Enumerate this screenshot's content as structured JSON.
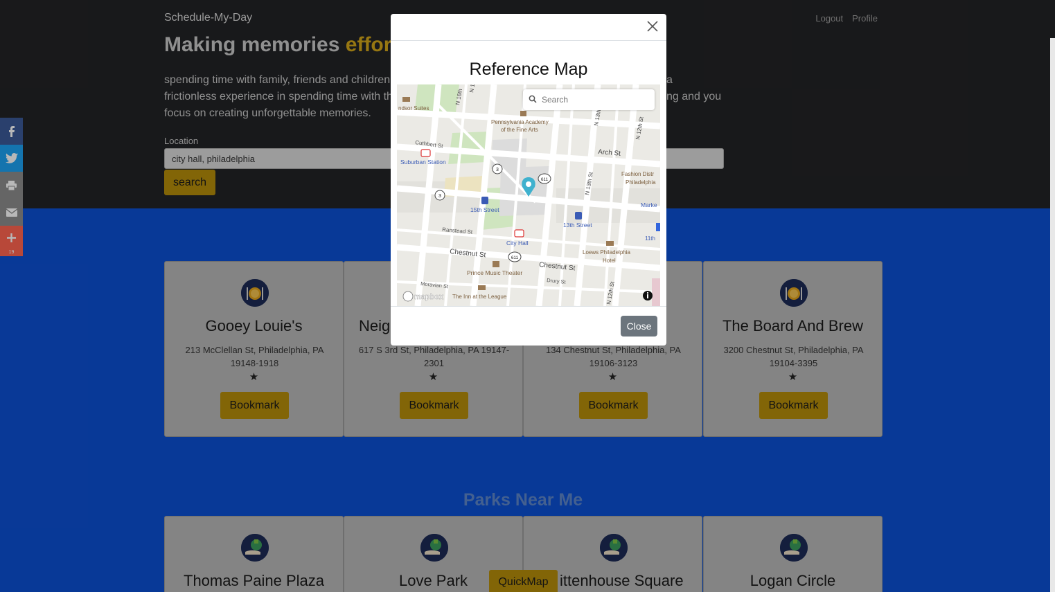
{
  "navbar": {
    "brand": "Schedule-My-Day",
    "links": [
      "Logout",
      "Profile"
    ]
  },
  "hero": {
    "headline": "Making memories ",
    "headline_accent": "effort",
    "tagline_lines": [
      "spending time with family, friends and children a",
      "frictionless experience in spending time with th",
      "focus on creating unforgettable memories."
    ],
    "tagline_right_1": "a",
    "tagline_right_2": "ng and you",
    "location_label": "Location",
    "location_value": "city hall, philadelphia",
    "search_label": "search"
  },
  "share": {
    "count": "19"
  },
  "restaurants": [
    {
      "title": "Gooey Louie's",
      "address": "213 McClellan St, Philadelphia, PA 19148-1918",
      "rating": "★",
      "button": "Bookmark"
    },
    {
      "title": "Neig",
      "address": "617 S 3rd St, Philadelphia, PA 19147-2301",
      "rating": "★",
      "button": "Bookmark"
    },
    {
      "title": "",
      "address": "134 Chestnut St, Philadelphia, PA 19106-3123",
      "rating": "★",
      "button": "Bookmark"
    },
    {
      "title": "The Board And Brew",
      "address": "3200 Chestnut St, Philadelphia, PA 19104-3395",
      "rating": "★",
      "button": "Bookmark"
    }
  ],
  "parks": {
    "heading": "Parks Near Me",
    "items": [
      {
        "title": "Thomas Paine Plaza"
      },
      {
        "title": "Love Park"
      },
      {
        "title": "ittenhouse Square"
      },
      {
        "title": "Logan Circle"
      }
    ]
  },
  "quickmap_label": "QuickMap",
  "modal": {
    "title": "Reference Map",
    "close_label": "Close",
    "map": {
      "search_placeholder": "Search",
      "labels": {
        "windsor": "ndsor Suites",
        "pafa_1": "Pennsylvania Academy",
        "pafa_2": "of the Fine Arts",
        "cuthbert": "Cuthbert St",
        "suburban": "Suburban Station",
        "arch": "Arch St",
        "fashion_1": "Fashion Distr",
        "fashion_2": "Philadelphia",
        "n16": "N 16th",
        "n15": "N 15",
        "n13": "N 13th St",
        "n12": "N 12th St",
        "n13b": "N 13th St",
        "fifteenth": "15th Street",
        "thirteenth": "13th Street",
        "market": "Marke",
        "ranstead": "Ranstead St",
        "cityhall": "City Hall",
        "eleventh": "11th",
        "loews_1": "Loews Philadelphia",
        "loews_2": "Hotel",
        "chestnut1": "Chestnut St",
        "chestnut2": "Chestnut St",
        "prince": "Prince Music Theater",
        "drury": "Drury St",
        "moravian": "Moravian St",
        "inn": "The Inn at the League",
        "n12b": "N 12th St",
        "mapbox": "mapbox",
        "r3a": "3",
        "r3b": "3",
        "r611a": "611",
        "r611b": "611"
      }
    }
  }
}
